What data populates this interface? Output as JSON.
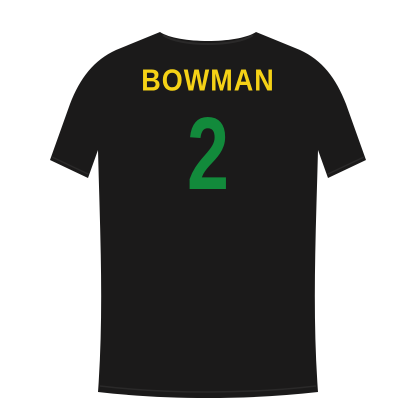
{
  "jersey": {
    "name": "BOWMAN",
    "number": "2",
    "shirt_color": "#1b1a1a",
    "name_color": "#f5d216",
    "number_color": "#128a3b"
  }
}
